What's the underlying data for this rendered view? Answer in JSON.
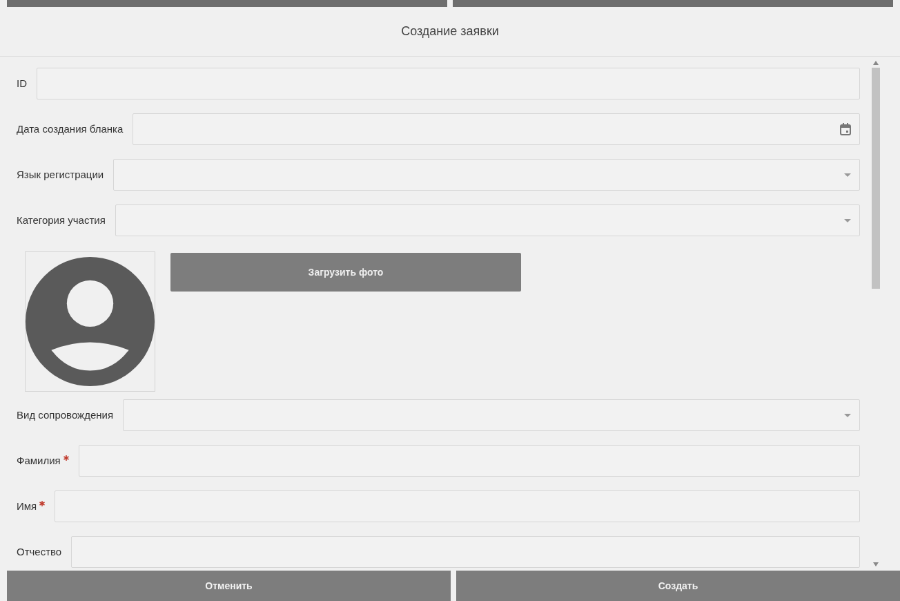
{
  "dialog": {
    "title": "Создание заявки"
  },
  "fields_top": [
    {
      "kind": "text",
      "label": "ID",
      "required": false
    },
    {
      "kind": "date",
      "label": "Дата создания бланка",
      "required": false
    },
    {
      "kind": "select",
      "label": "Язык регистрации",
      "required": false
    },
    {
      "kind": "select",
      "label": "Категория участия",
      "required": false
    }
  ],
  "photo": {
    "button": "Загрузить фото"
  },
  "fields_bottom": [
    {
      "kind": "select",
      "label": "Вид сопровождения",
      "required": false
    },
    {
      "kind": "text",
      "label": "Фамилия",
      "required": true
    },
    {
      "kind": "text",
      "label": "Имя",
      "required": true
    },
    {
      "kind": "text",
      "label": "Отчество",
      "required": false
    }
  ],
  "buttons": [
    "Отменить",
    "Создать"
  ]
}
